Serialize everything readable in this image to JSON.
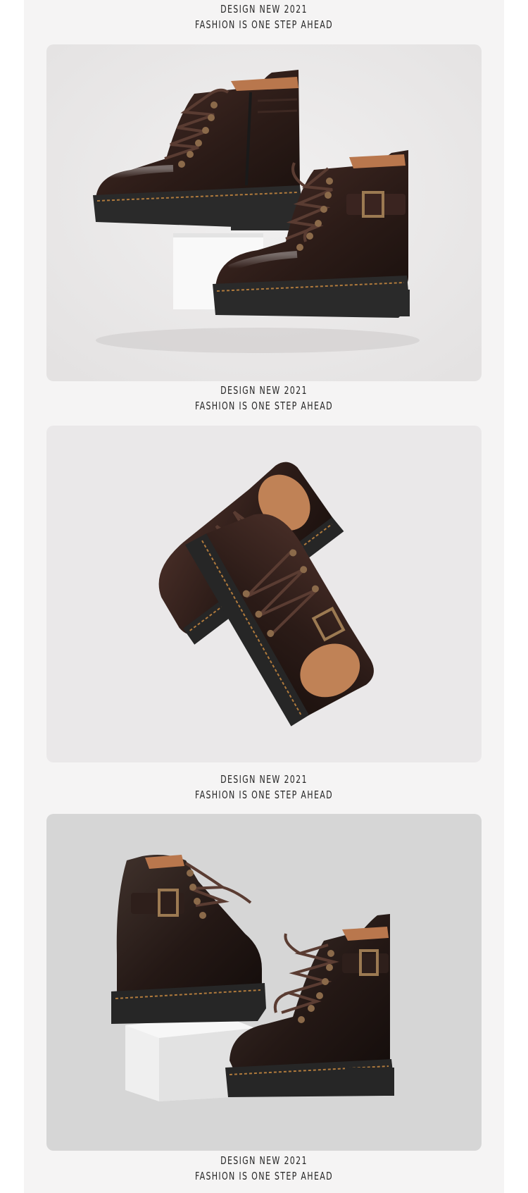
{
  "sections": [
    {
      "headline": "DESIGN NEW 2021",
      "tagline": "FASHION IS ONE STEP AHEAD"
    },
    {
      "headline": "DESIGN NEW 2021",
      "tagline": "FASHION IS ONE STEP AHEAD"
    },
    {
      "headline": "DESIGN NEW 2021",
      "tagline": "FASHION IS ONE STEP AHEAD"
    },
    {
      "headline": "DESIGN NEW 2021",
      "tagline": "FASHION IS ONE STEP AHEAD"
    }
  ],
  "colors": {
    "page_background": "#ffffff",
    "panel_background": "#f5f4f4",
    "photo_background_light": "#eceaea",
    "photo_background_grey": "#d6d6d6",
    "leather": "#2b1c18",
    "sole": "#1f1f1f",
    "stitching": "#b07a3c",
    "lining": "#c2855a",
    "text": "#262626"
  },
  "photos": [
    {
      "subject": "boot-pair-side-view-icon"
    },
    {
      "subject": "boot-pair-top-view-icon"
    },
    {
      "subject": "boot-pair-back-view-icon"
    }
  ]
}
